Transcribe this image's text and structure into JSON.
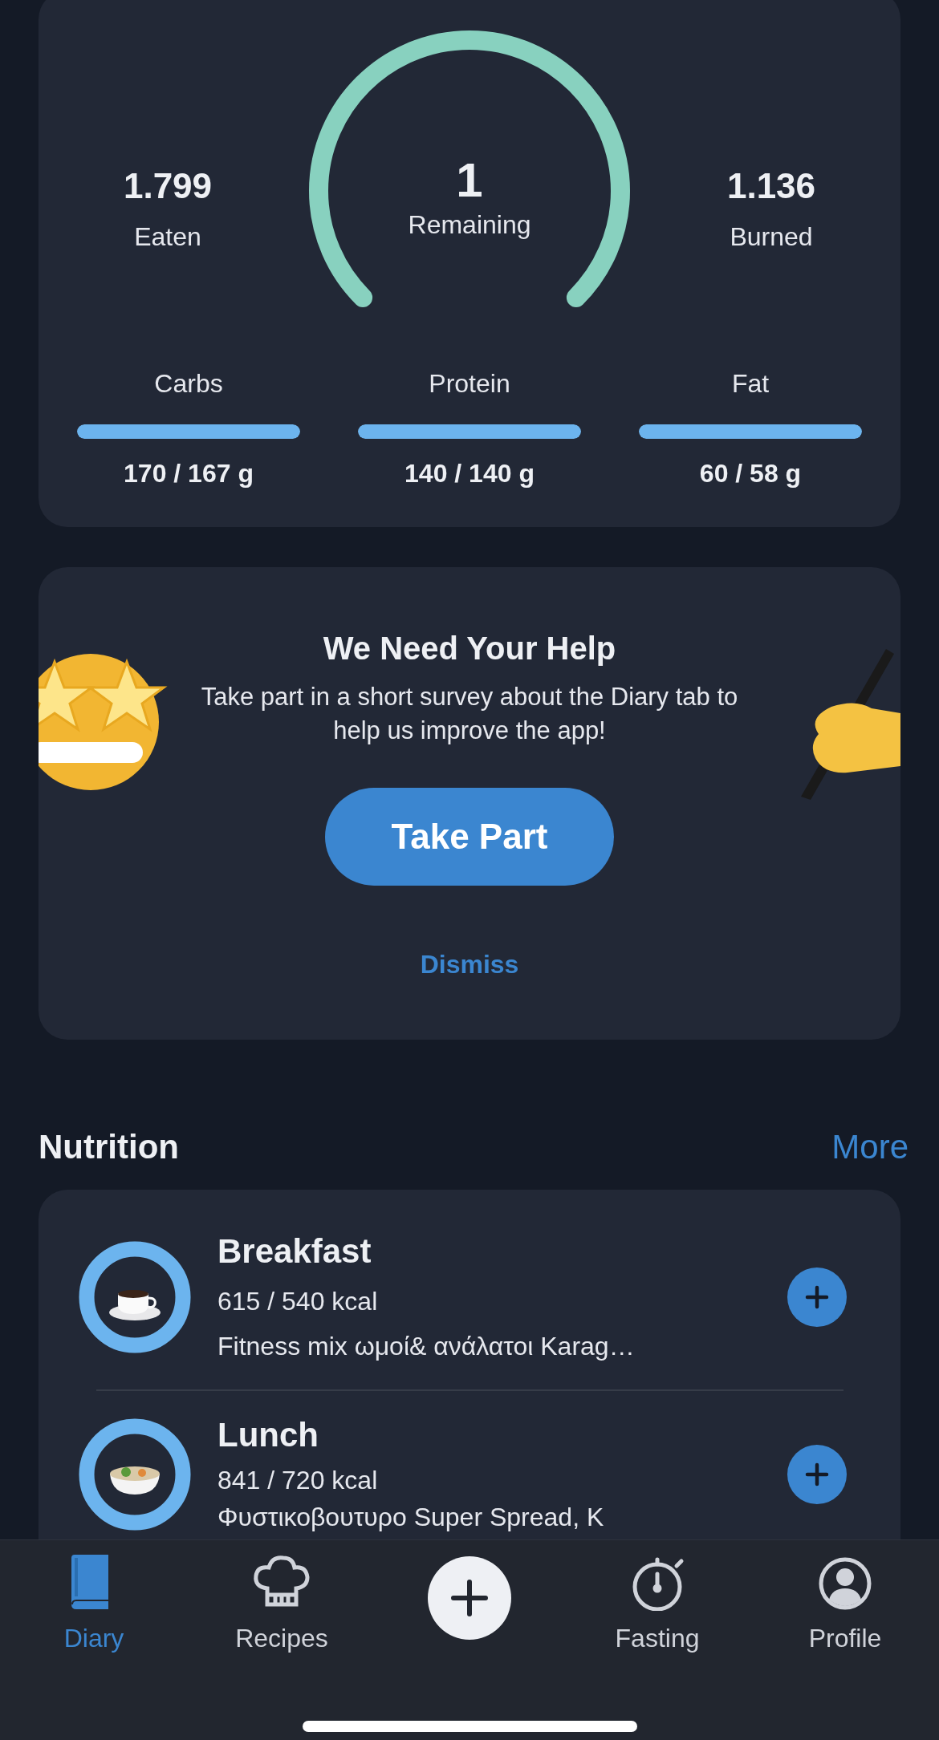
{
  "summary": {
    "eaten": {
      "value": "1.799",
      "label": "Eaten"
    },
    "remaining": {
      "value": "1",
      "label": "Remaining"
    },
    "burned": {
      "value": "1.136",
      "label": "Burned"
    },
    "macros": [
      {
        "name": "Carbs",
        "level": 1,
        "amount": "170 / 167 g"
      },
      {
        "name": "Protein",
        "level": 1,
        "amount": "140 / 140 g"
      },
      {
        "name": "Fat",
        "level": 1,
        "amount": "60 / 58 g"
      }
    ]
  },
  "survey": {
    "title": "We Need Your Help",
    "text": "Take part in a short survey about the Diary tab to help us improve the app!",
    "button": "Take Part",
    "dismiss": "Dismiss"
  },
  "nutrition": {
    "title": "Nutrition",
    "more": "More",
    "meals": [
      {
        "name": "Breakfast",
        "kind": "coffee",
        "level": 1,
        "kcal": "615 / 540 kcal",
        "items": "Fitness mix ωμοί& ανάλατοι Karag…"
      },
      {
        "name": "Lunch",
        "kind": "bowl",
        "level": 1,
        "kcal": "841 / 720 kcal",
        "items": "Φυστικοβουτυρο Super Spread, K"
      }
    ]
  },
  "tab_bar": [
    {
      "label": "Diary",
      "kind": "book",
      "selected": true
    },
    {
      "label": "Recipes",
      "kind": "chef",
      "selected": false
    },
    {
      "kind": "add",
      "selected": false
    },
    {
      "label": "Fasting",
      "kind": "timer",
      "selected": false
    },
    {
      "label": "Profile",
      "kind": "person",
      "selected": false
    }
  ]
}
